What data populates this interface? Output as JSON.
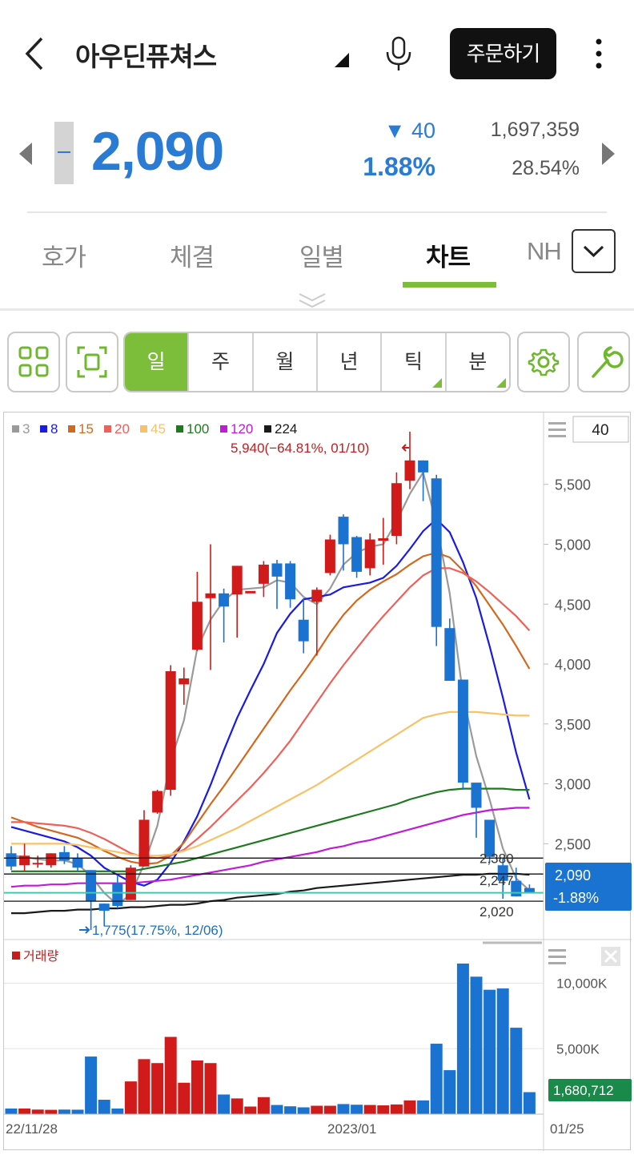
{
  "header": {
    "stock_name": "아우딘퓨쳐스",
    "order_label": "주문하기"
  },
  "quote": {
    "price": "2,090",
    "change": "▼ 40",
    "change_pct": "1.88%",
    "volume": "1,697,359",
    "turnover_pct": "28.54%"
  },
  "tabs": [
    "호가",
    "체결",
    "일별",
    "차트",
    "NH"
  ],
  "active_tab": "차트",
  "period_buttons": [
    "일",
    "주",
    "월",
    "년",
    "틱",
    "분"
  ],
  "active_period": "일",
  "colors": {
    "accent_green": "#7cbd3a",
    "down_blue": "#1a73d1",
    "up_red": "#d11a1a",
    "current_price_line": "#3ec9b4"
  },
  "icons": [
    "back-icon",
    "dropdown-triangle-icon",
    "microphone-icon",
    "more-vertical-icon",
    "grid-icon",
    "fullscreen-icon",
    "settings-gear-icon",
    "wrench-icon",
    "chevron-down-icon"
  ],
  "chart": {
    "ma_legend": [
      {
        "label": "3",
        "color": "#9a9a9a"
      },
      {
        "label": "8",
        "color": "#1a1ae6"
      },
      {
        "label": "15",
        "color": "#d2691e"
      },
      {
        "label": "20",
        "color": "#f0605a"
      },
      {
        "label": "45",
        "color": "#f8c266"
      },
      {
        "label": "100",
        "color": "#1f7a1f"
      },
      {
        "label": "120",
        "color": "#c01bd6"
      },
      {
        "label": "224",
        "color": "#1a1a1a"
      }
    ],
    "zoom_value": "40",
    "high_annotation": "5,940(−64.81%, 01/10)",
    "low_annotation": "1,775(17.75%, 12/06)",
    "hline_labels": [
      "2,380",
      "2,247",
      "2,020"
    ],
    "current_price_tag": "2,090",
    "current_pct_tag": "-1.88%",
    "volume_label": "거래량",
    "volume_current_tag": "1,680,712",
    "x_labels": [
      "22/11/28",
      "2023/01",
      "01/25"
    ]
  },
  "chart_data": {
    "type": "candlestick",
    "y_ticks": [
      2500,
      3000,
      3500,
      4000,
      4500,
      5000,
      5500
    ],
    "y_tick_labels": [
      "2,500",
      "3,000",
      "3,500",
      "4,000",
      "4,500",
      "5,000",
      "5,500"
    ],
    "ylim": [
      1700,
      6100
    ],
    "candles": [
      {
        "o": 2420,
        "h": 2480,
        "l": 2280,
        "c": 2310
      },
      {
        "o": 2320,
        "h": 2500,
        "l": 2270,
        "c": 2400
      },
      {
        "o": 2340,
        "h": 2400,
        "l": 2300,
        "c": 2340
      },
      {
        "o": 2320,
        "h": 2420,
        "l": 2300,
        "c": 2420
      },
      {
        "o": 2430,
        "h": 2480,
        "l": 2330,
        "c": 2360
      },
      {
        "o": 2380,
        "h": 2420,
        "l": 2270,
        "c": 2300
      },
      {
        "o": 2280,
        "h": 2280,
        "l": 1780,
        "c": 2020
      },
      {
        "o": 2000,
        "h": 2000,
        "l": 1810,
        "c": 1940
      },
      {
        "o": 2170,
        "h": 2230,
        "l": 1960,
        "c": 1980
      },
      {
        "o": 2030,
        "h": 2320,
        "l": 2030,
        "c": 2300
      },
      {
        "o": 2310,
        "h": 2780,
        "l": 2310,
        "c": 2700
      },
      {
        "o": 2760,
        "h": 2950,
        "l": 2750,
        "c": 2940
      },
      {
        "o": 2950,
        "h": 3990,
        "l": 2900,
        "c": 3940
      },
      {
        "o": 3830,
        "h": 3970,
        "l": 3660,
        "c": 3880
      },
      {
        "o": 4120,
        "h": 4770,
        "l": 4110,
        "c": 4520
      },
      {
        "o": 4550,
        "h": 5000,
        "l": 3950,
        "c": 4590
      },
      {
        "o": 4590,
        "h": 4630,
        "l": 4180,
        "c": 4480
      },
      {
        "o": 4580,
        "h": 4820,
        "l": 4220,
        "c": 4820
      },
      {
        "o": 4590,
        "h": 4600,
        "l": 4600,
        "c": 4610
      },
      {
        "o": 4670,
        "h": 4860,
        "l": 4560,
        "c": 4830
      },
      {
        "o": 4840,
        "h": 4870,
        "l": 4460,
        "c": 4730
      },
      {
        "o": 4840,
        "h": 4860,
        "l": 4470,
        "c": 4540
      },
      {
        "o": 4370,
        "h": 4540,
        "l": 4090,
        "c": 4190
      },
      {
        "o": 4520,
        "h": 4640,
        "l": 4070,
        "c": 4620
      },
      {
        "o": 4760,
        "h": 5080,
        "l": 4740,
        "c": 5040
      },
      {
        "o": 5230,
        "h": 5250,
        "l": 4780,
        "c": 5000
      },
      {
        "o": 5060,
        "h": 5070,
        "l": 4720,
        "c": 4770
      },
      {
        "o": 4800,
        "h": 5090,
        "l": 4740,
        "c": 5040
      },
      {
        "o": 5030,
        "h": 5220,
        "l": 4830,
        "c": 5050
      },
      {
        "o": 5070,
        "h": 5600,
        "l": 5000,
        "c": 5510
      },
      {
        "o": 5530,
        "h": 5940,
        "l": 5460,
        "c": 5700
      },
      {
        "o": 5700,
        "h": 5700,
        "l": 5360,
        "c": 5600
      },
      {
        "o": 5550,
        "h": 5580,
        "l": 4150,
        "c": 4310
      },
      {
        "o": 4300,
        "h": 4380,
        "l": 3870,
        "c": 3860
      },
      {
        "o": 3870,
        "h": 3860,
        "l": 2950,
        "c": 3010
      },
      {
        "o": 3010,
        "h": 2950,
        "l": 2550,
        "c": 2800
      },
      {
        "o": 2700,
        "h": 2690,
        "l": 2340,
        "c": 2390
      },
      {
        "o": 2320,
        "h": 2380,
        "l": 2040,
        "c": 2190
      },
      {
        "o": 2190,
        "h": 2300,
        "l": 2060,
        "c": 2060
      },
      {
        "o": 2130,
        "h": 2160,
        "l": 2090,
        "c": 2090
      }
    ],
    "ma": {
      "3": [
        2400,
        2390,
        2370,
        2360,
        2360,
        2330,
        2230,
        2090,
        1990,
        2080,
        2330,
        2650,
        3190,
        3530,
        4130,
        4370,
        4530,
        4620,
        4630,
        4640,
        4700,
        4680,
        4560,
        4500,
        4630,
        4830,
        4930,
        4980,
        5000,
        5190,
        5420,
        5600,
        5170,
        4590,
        3740,
        3230,
        2870,
        2460,
        2210,
        2110
      ],
      "8": [
        2640,
        2610,
        2580,
        2550,
        2520,
        2470,
        2400,
        2300,
        2240,
        2180,
        2150,
        2200,
        2340,
        2520,
        2730,
        2990,
        3280,
        3550,
        3780,
        4000,
        4260,
        4420,
        4540,
        4560,
        4580,
        4640,
        4660,
        4680,
        4720,
        4820,
        4960,
        5110,
        5210,
        5100,
        4850,
        4550,
        4150,
        3720,
        3260,
        2870
      ],
      "15": [
        2720,
        2680,
        2640,
        2610,
        2580,
        2550,
        2500,
        2440,
        2390,
        2350,
        2330,
        2340,
        2400,
        2510,
        2670,
        2830,
        2980,
        3140,
        3300,
        3460,
        3620,
        3780,
        3930,
        4090,
        4260,
        4410,
        4530,
        4620,
        4690,
        4750,
        4830,
        4900,
        4930,
        4890,
        4780,
        4650,
        4490,
        4330,
        4150,
        3960
      ],
      "20": [
        2680,
        2680,
        2670,
        2660,
        2650,
        2630,
        2590,
        2540,
        2480,
        2420,
        2390,
        2380,
        2400,
        2450,
        2540,
        2640,
        2750,
        2860,
        2970,
        3090,
        3220,
        3360,
        3520,
        3680,
        3840,
        3990,
        4130,
        4270,
        4400,
        4520,
        4640,
        4740,
        4800,
        4800,
        4760,
        4690,
        4600,
        4500,
        4400,
        4280
      ],
      "45": [
        2500,
        2500,
        2500,
        2500,
        2500,
        2490,
        2470,
        2450,
        2430,
        2410,
        2400,
        2400,
        2410,
        2440,
        2480,
        2530,
        2580,
        2630,
        2690,
        2750,
        2810,
        2870,
        2930,
        2990,
        3060,
        3130,
        3200,
        3270,
        3340,
        3410,
        3480,
        3550,
        3580,
        3600,
        3600,
        3600,
        3590,
        3580,
        3570,
        3570
      ],
      "100": [
        2270,
        2270,
        2270,
        2270,
        2270,
        2270,
        2270,
        2270,
        2270,
        2270,
        2290,
        2310,
        2330,
        2350,
        2380,
        2410,
        2440,
        2470,
        2500,
        2530,
        2560,
        2590,
        2620,
        2650,
        2680,
        2710,
        2740,
        2770,
        2800,
        2830,
        2870,
        2900,
        2930,
        2950,
        2960,
        2960,
        2960,
        2960,
        2950,
        2950
      ],
      "120": [
        2140,
        2150,
        2150,
        2160,
        2160,
        2170,
        2170,
        2170,
        2170,
        2170,
        2180,
        2190,
        2200,
        2220,
        2240,
        2260,
        2280,
        2300,
        2320,
        2350,
        2370,
        2390,
        2410,
        2430,
        2460,
        2480,
        2510,
        2530,
        2560,
        2590,
        2620,
        2650,
        2680,
        2710,
        2740,
        2760,
        2780,
        2790,
        2800,
        2800
      ],
      "224": [
        1920,
        1920,
        1930,
        1940,
        1940,
        1950,
        1950,
        1960,
        1960,
        1970,
        1970,
        1980,
        1990,
        1990,
        2000,
        2020,
        2030,
        2050,
        2060,
        2070,
        2080,
        2100,
        2110,
        2130,
        2140,
        2150,
        2160,
        2170,
        2180,
        2190,
        2200,
        2210,
        2220,
        2230,
        2240,
        2240,
        2250,
        2250,
        2250,
        2240
      ]
    },
    "hlines": [
      2380,
      2247,
      2020
    ],
    "current_price": 2090,
    "volume": {
      "y_ticks": [
        5000,
        10000
      ],
      "y_tick_labels": [
        "5,000K",
        "10,000K"
      ],
      "ylim": [
        0,
        11500
      ],
      "values": [
        430,
        430,
        350,
        330,
        350,
        340,
        4400,
        1100,
        430,
        2500,
        4200,
        3900,
        5900,
        2400,
        4100,
        3900,
        1500,
        1200,
        580,
        1300,
        700,
        600,
        520,
        640,
        640,
        770,
        720,
        700,
        670,
        740,
        1050,
        1050,
        5380,
        3360,
        11500,
        10500,
        9500,
        9600,
        6600,
        1680
      ]
    }
  }
}
